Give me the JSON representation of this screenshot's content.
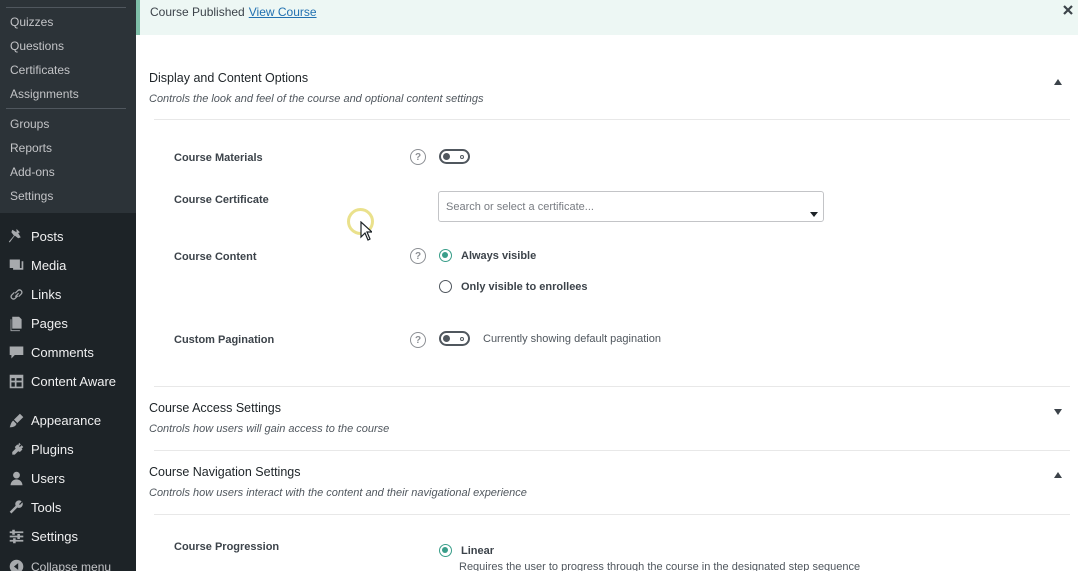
{
  "sidebar": {
    "submenu": [
      "Quizzes",
      "Questions",
      "Certificates",
      "Assignments",
      "Groups",
      "Reports",
      "Add-ons",
      "Settings"
    ],
    "menu": [
      {
        "label": "Posts",
        "icon": "pin-icon"
      },
      {
        "label": "Media",
        "icon": "media-icon"
      },
      {
        "label": "Links",
        "icon": "link-icon"
      },
      {
        "label": "Pages",
        "icon": "pages-icon"
      },
      {
        "label": "Comments",
        "icon": "comments-icon"
      },
      {
        "label": "Content Aware",
        "icon": "grid-icon"
      },
      {
        "label": "Appearance",
        "icon": "brush-icon"
      },
      {
        "label": "Plugins",
        "icon": "plug-icon"
      },
      {
        "label": "Users",
        "icon": "user-icon"
      },
      {
        "label": "Tools",
        "icon": "wrench-icon"
      },
      {
        "label": "Settings",
        "icon": "sliders-icon"
      },
      {
        "label": "Collapse menu",
        "icon": "collapse-icon"
      }
    ]
  },
  "notice": {
    "text": "Course Published",
    "link": "View Course"
  },
  "sections": {
    "display": {
      "title": "Display and Content Options",
      "desc": "Controls the look and feel of the course and optional content settings"
    },
    "access": {
      "title": "Course Access Settings",
      "desc": "Controls how users will gain access to the course"
    },
    "navigation": {
      "title": "Course Navigation Settings",
      "desc": "Controls how users interact with the content and their navigational experience"
    }
  },
  "fields": {
    "materials": {
      "label": "Course Materials",
      "enabled": false
    },
    "certificate": {
      "label": "Course Certificate",
      "placeholder": "Search or select a certificate..."
    },
    "content": {
      "label": "Course Content",
      "options": [
        "Always visible",
        "Only visible to enrollees"
      ],
      "selected": "Always visible"
    },
    "pagination": {
      "label": "Custom Pagination",
      "enabled": false,
      "note": "Currently showing default pagination"
    },
    "progression": {
      "label": "Course Progression",
      "option": "Linear",
      "desc": "Requires the user to progress through the course in the designated step sequence"
    }
  },
  "help_mark": "?",
  "colors": {
    "sidebar_bg": "#1d2327",
    "submenu_bg": "#2c3338",
    "notice_bg": "#edf7f4",
    "accent": "#3a9e8a",
    "link": "#2271b1"
  }
}
